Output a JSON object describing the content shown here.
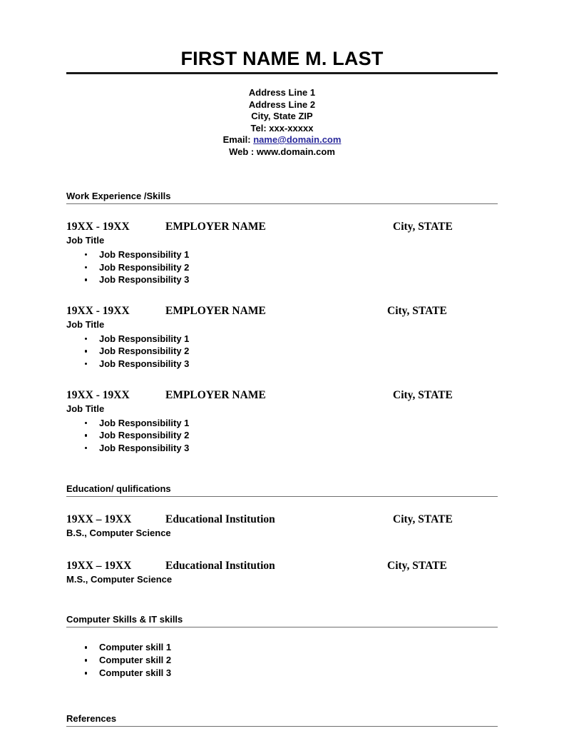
{
  "header": {
    "name": "FIRST NAME M. LAST",
    "contact": {
      "address_line_1": "Address Line 1",
      "address_line_2": "Address Line 2",
      "city_state_zip": "City, State ZIP",
      "telephone": "Tel: xxx-xxxxx",
      "email_label": "Email:",
      "email_value": "name@domain.com",
      "web": "Web : www.domain.com"
    },
    "link_color": "#2a2a9c"
  },
  "sections": {
    "work": {
      "heading": "Work Experience /Skills",
      "entries": [
        {
          "dates": "19XX - 19XX",
          "employer": "EMPLOYER NAME",
          "location": "City, STATE",
          "job_title": "Job Title",
          "responsibilities": [
            "Job Responsibility 1",
            "Job Responsibility 2",
            "Job Responsibility 3"
          ]
        },
        {
          "dates": "19XX - 19XX",
          "employer": "EMPLOYER NAME",
          "location": "City, STATE",
          "job_title": "Job Title",
          "responsibilities": [
            "Job Responsibility 1",
            "Job Responsibility 2",
            "Job Responsibility 3"
          ]
        },
        {
          "dates": "19XX - 19XX",
          "employer": "EMPLOYER NAME",
          "location": "City, STATE",
          "job_title": "Job Title",
          "responsibilities": [
            "Job Responsibility 1",
            "Job Responsibility 2",
            "Job Responsibility 3"
          ]
        }
      ]
    },
    "education": {
      "heading": "Education/ qulifications",
      "entries": [
        {
          "dates": "19XX – 19XX",
          "institution": "Educational Institution",
          "location": "City, STATE",
          "degree": "B.S., Computer Science"
        },
        {
          "dates": "19XX – 19XX",
          "institution": "Educational Institution",
          "location": "City, STATE",
          "degree": "M.S., Computer Science"
        }
      ]
    },
    "skills": {
      "heading": "Computer Skills & IT skills",
      "items": [
        "Computer skill 1",
        "Computer skill 2",
        "Computer skill 3"
      ]
    },
    "references": {
      "heading": "References"
    }
  }
}
